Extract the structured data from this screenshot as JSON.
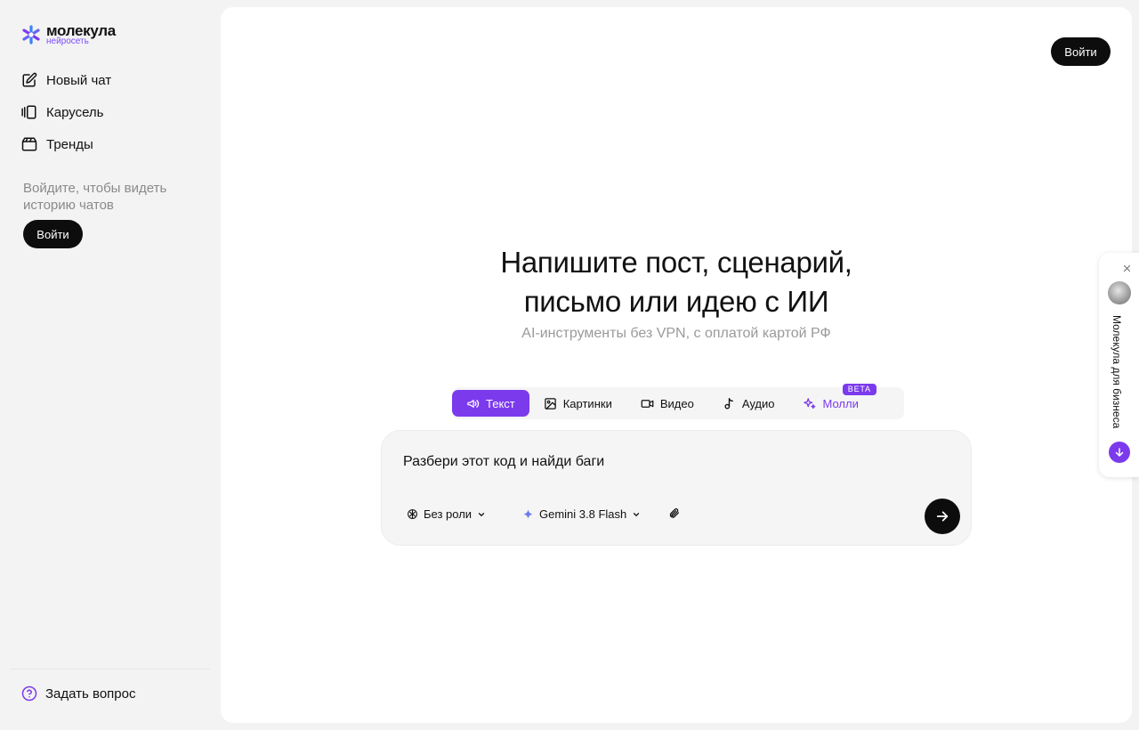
{
  "brand": {
    "name": "молекула",
    "subtitle": "нейросеть",
    "accent": "#7c3aed"
  },
  "sidebar": {
    "items": [
      {
        "label": "Новый чат",
        "icon": "edit-icon"
      },
      {
        "label": "Карусель",
        "icon": "carousel-icon"
      },
      {
        "label": "Тренды",
        "icon": "trends-icon"
      }
    ],
    "login_hint": "Войдите, чтобы видеть историю чатов",
    "login_button": "Войти",
    "help_label": "Задать вопрос"
  },
  "header": {
    "login_button": "Войти"
  },
  "hero": {
    "title_line1": "Напишите пост, сценарий,",
    "title_line2": "письмо или идею с ИИ",
    "subtitle": "AI-инструменты без VPN, с оплатой картой РФ"
  },
  "tabs": [
    {
      "label": "Текст",
      "icon": "megaphone-icon",
      "active": true
    },
    {
      "label": "Картинки",
      "icon": "image-icon"
    },
    {
      "label": "Видео",
      "icon": "video-icon"
    },
    {
      "label": "Аудио",
      "icon": "music-note-icon"
    },
    {
      "label": "Молли",
      "icon": "sparkles-icon",
      "badge": "BETA"
    }
  ],
  "composer": {
    "input_value": "Разбери этот код и найди баги",
    "role_label": "Без роли",
    "model_label": "Gemini 3.8 Flash"
  },
  "promo": {
    "label": "Молекула для бизнеса"
  }
}
